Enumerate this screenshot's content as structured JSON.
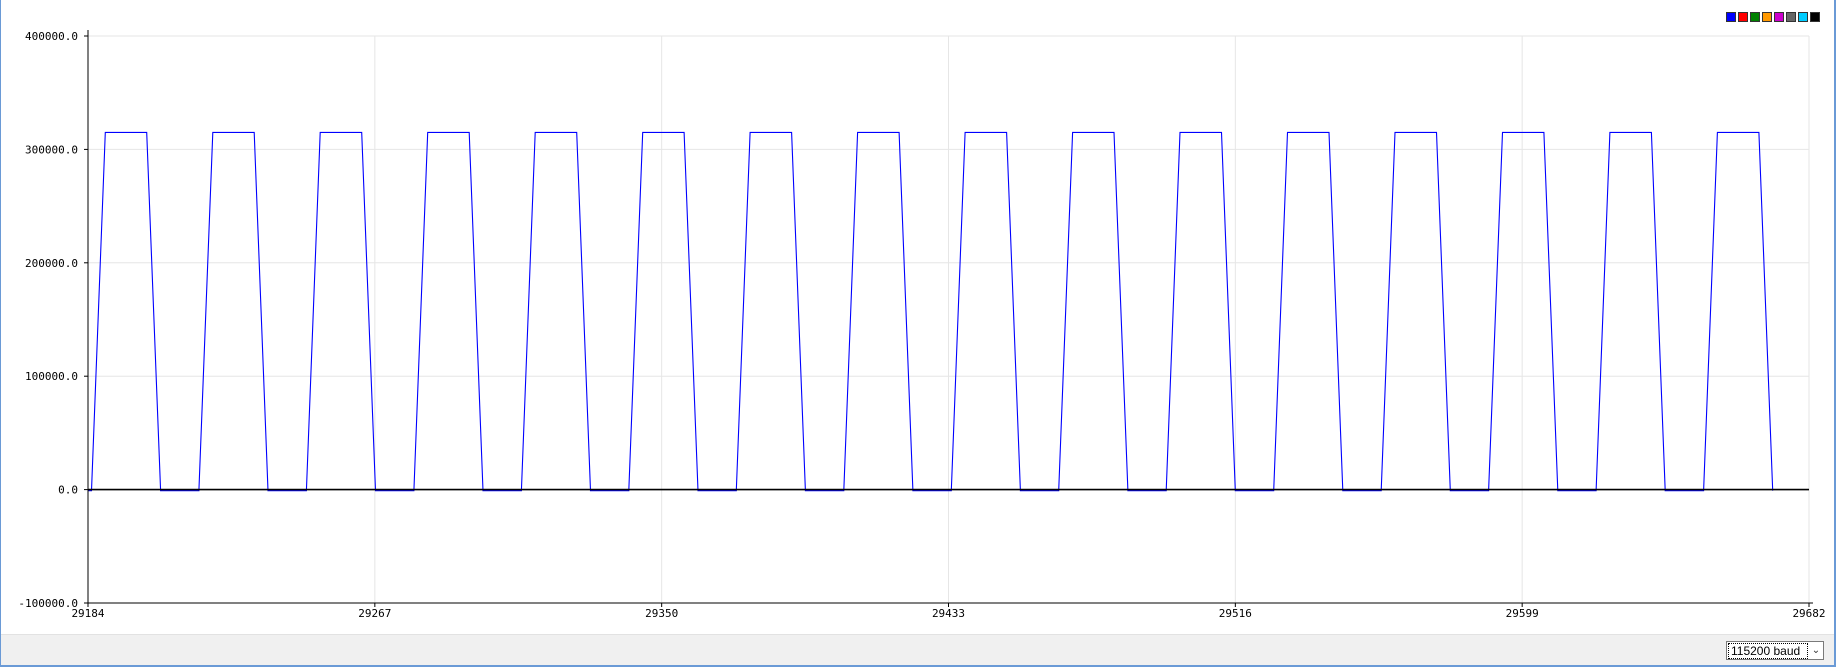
{
  "chart_data": {
    "type": "line",
    "title": "",
    "xlabel": "",
    "ylabel": "",
    "xlim": [
      29184,
      29682
    ],
    "ylim": [
      -100000,
      400000
    ],
    "y_ticks": [
      "400000.0",
      "300000.0",
      "200000.0",
      "100000.0",
      "0.0",
      "-100000.0"
    ],
    "x_ticks": [
      "29184",
      "29267",
      "29350",
      "29433",
      "29516",
      "29599",
      "29682"
    ],
    "grid": true,
    "legend_position": "top-right",
    "series": [
      {
        "color": "#0000ff",
        "waveform": {
          "start": 29185,
          "period": 31.1,
          "high_value": 315000,
          "low_value": -1000,
          "rise_width": 4,
          "high_width": 12,
          "fall_width": 4,
          "low_width": 11
        }
      },
      {
        "color": "#000000",
        "constant": 0
      }
    ]
  },
  "legend": {
    "swatches": [
      "#0000ff",
      "#ff0000",
      "#008000",
      "#ff9900",
      "#cc00cc",
      "#666666",
      "#00ccff",
      "#000000"
    ]
  },
  "controls": {
    "baud_value": "115200 baud"
  }
}
